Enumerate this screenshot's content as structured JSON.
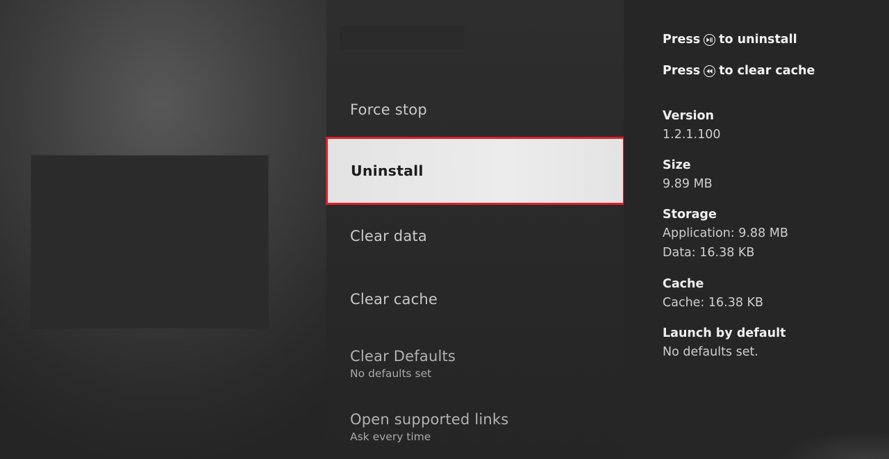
{
  "menu": {
    "items": [
      {
        "label": "Force stop",
        "sub": ""
      },
      {
        "label": "Uninstall",
        "sub": ""
      },
      {
        "label": "Clear data",
        "sub": ""
      },
      {
        "label": "Clear cache",
        "sub": ""
      },
      {
        "label": "Clear Defaults",
        "sub": "No defaults set"
      },
      {
        "label": "Open supported links",
        "sub": "Ask every time"
      }
    ],
    "selected_index": 1
  },
  "hints": {
    "uninstall": {
      "prefix": "Press",
      "suffix": "to uninstall",
      "icon": "play-pause-icon"
    },
    "clear_cache": {
      "prefix": "Press",
      "suffix": "to clear cache",
      "icon": "rewind-icon"
    }
  },
  "info": {
    "version": {
      "heading": "Version",
      "value": "1.2.1.100"
    },
    "size": {
      "heading": "Size",
      "value": "9.89 MB"
    },
    "storage": {
      "heading": "Storage",
      "application": "Application: 9.88 MB",
      "data": "Data: 16.38 KB"
    },
    "cache": {
      "heading": "Cache",
      "value": "Cache: 16.38 KB"
    },
    "launch": {
      "heading": "Launch by default",
      "value": "No defaults set."
    }
  },
  "colors": {
    "selection_outline": "#e21e26",
    "background": "#262626"
  }
}
